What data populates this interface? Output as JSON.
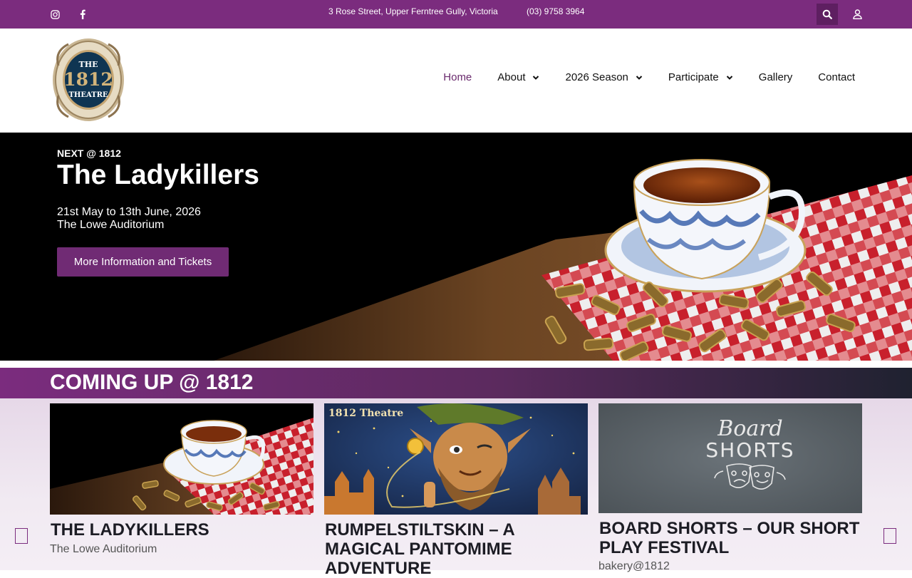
{
  "topbar": {
    "address": "3 Rose Street, Upper Ferntree Gully, Victoria",
    "phone": "(03) 9758 3964",
    "icons": [
      "instagram-icon",
      "facebook-icon",
      "search-icon",
      "user-icon"
    ]
  },
  "logo": {
    "line1": "THE",
    "line2": "1812",
    "line3": "THEATRE"
  },
  "nav": {
    "home": "Home",
    "about": "About",
    "season": "2026 Season",
    "participate": "Participate",
    "gallery": "Gallery",
    "contact": "Contact"
  },
  "hero": {
    "kicker": "NEXT @ 1812",
    "title": "The Ladykillers",
    "date": "21st May to 13th June, 2026",
    "venue": "The Lowe Auditorium",
    "cta": "More Information and Tickets"
  },
  "coming_up": {
    "heading": "COMING UP @ 1812",
    "cards": [
      {
        "title": "THE LADYKILLERS",
        "subtitle": "The Lowe Auditorium"
      },
      {
        "title": "RUMPELSTILTSKIN – A MAGICAL PANTOMIME ADVENTURE",
        "subtitle": "",
        "image_text": "1812 Theatre"
      },
      {
        "title": "BOARD SHORTS – OUR SHORT PLAY FESTIVAL",
        "subtitle": "bakery@1812",
        "image_text_1": "Board",
        "image_text_2": "SHORTS"
      }
    ]
  },
  "colors": {
    "brand_purple": "#7b2c7e",
    "button_purple": "#702b74"
  }
}
